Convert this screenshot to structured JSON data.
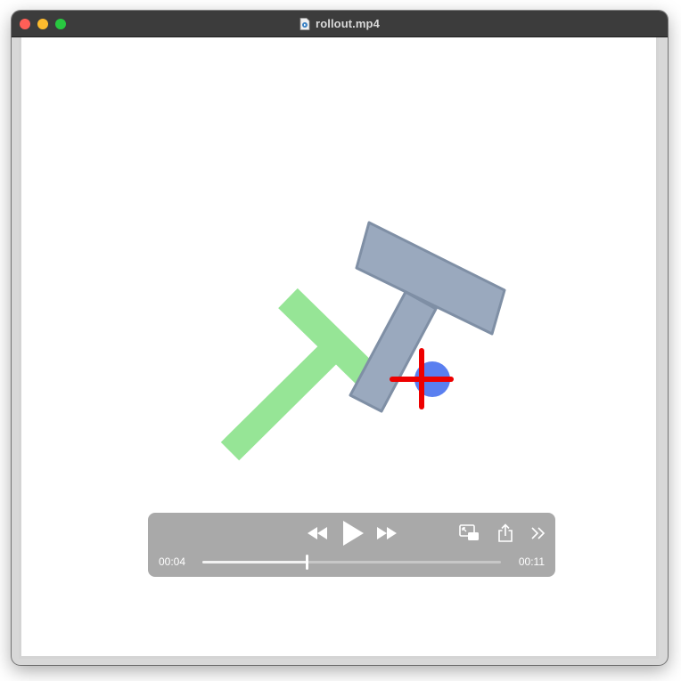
{
  "window": {
    "title": "rollout.mp4",
    "buttons": {
      "close": "close-icon",
      "minimize": "minimize-icon",
      "zoom": "zoom-icon"
    }
  },
  "scene": {
    "target_color": "#96e596",
    "block_color": "#9aa9be",
    "agent_color": "#5a7ff0",
    "cursor_color": "#ee0000"
  },
  "player": {
    "current_time": "00:04",
    "duration": "00:11",
    "progress": 0.35,
    "icons": {
      "rewind": "rewind-icon",
      "play": "play-icon",
      "fast_forward": "fast-forward-icon",
      "picture_in_picture": "picture-in-picture-icon",
      "share": "share-icon",
      "more": "chevron-double-right-icon"
    }
  }
}
